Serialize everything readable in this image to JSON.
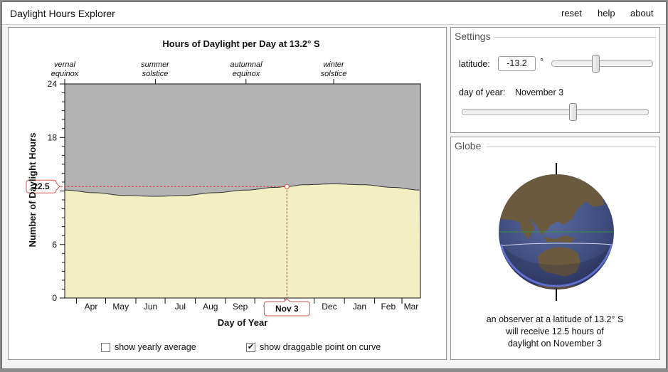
{
  "app": {
    "title": "Daylight Hours Explorer"
  },
  "menu": {
    "reset": "reset",
    "help": "help",
    "about": "about"
  },
  "chart": {
    "title": "Hours of Daylight per Day at 13.2° S",
    "xlabel": "Day of Year",
    "ylabel": "Number of Daylight Hours",
    "events": [
      {
        "line1": "vernal",
        "line2": "equinox"
      },
      {
        "line1": "summer",
        "line2": "solstice"
      },
      {
        "line1": "autumnal",
        "line2": "equinox"
      },
      {
        "line1": "winter",
        "line2": "solstice"
      }
    ],
    "y_ticks": [
      "0",
      "6",
      "12",
      "18",
      "24"
    ],
    "month_ticks": [
      "Apr",
      "May",
      "Jun",
      "Jul",
      "Aug",
      "Sep",
      "Oct",
      "Nov",
      "Dec",
      "Jan",
      "Feb",
      "Mar"
    ],
    "value_badge": "12.5",
    "date_badge": "Nov 3",
    "colors": {
      "night": "#b3b3b3",
      "day": "#f2f0c2",
      "marker": "#d9534f"
    }
  },
  "chart_data": {
    "type": "area",
    "title": "Hours of Daylight per Day at 13.2° S",
    "xlabel": "Day of Year",
    "ylabel": "Number of Daylight Hours",
    "ylim": [
      0,
      24
    ],
    "x_start": "Mar 20",
    "x": [
      "Mar 20",
      "Apr 20",
      "May 20",
      "Jun 21",
      "Jul 21",
      "Aug 20",
      "Sep 22",
      "Oct 22",
      "Nov 3",
      "Nov 21",
      "Dec 21",
      "Jan 20",
      "Feb 20",
      "Mar 20"
    ],
    "daylight_hours": [
      12.1,
      11.8,
      11.5,
      11.4,
      11.5,
      11.8,
      12.1,
      12.4,
      12.5,
      12.7,
      12.8,
      12.7,
      12.4,
      12.1
    ],
    "selected_point": {
      "date": "Nov 3",
      "hours": 12.5
    },
    "grid": false
  },
  "settings": {
    "title": "Settings",
    "latitude_label": "latitude:",
    "latitude_value": "-13.2",
    "latitude_unit": "°",
    "latitude_fraction": 0.43,
    "day_label": "day of year:",
    "day_value": "November 3",
    "day_fraction": 0.6
  },
  "globe": {
    "title": "Globe",
    "caption_lines": [
      "an observer at a latitude of 13.2° S",
      "will receive 12.5 hours of",
      "daylight on November 3"
    ]
  },
  "options": {
    "yearly_average_label": "show yearly average",
    "yearly_average_checked": false,
    "draggable_point_label": "show draggable point on curve",
    "draggable_point_checked": true,
    "check_mark": "✔"
  }
}
